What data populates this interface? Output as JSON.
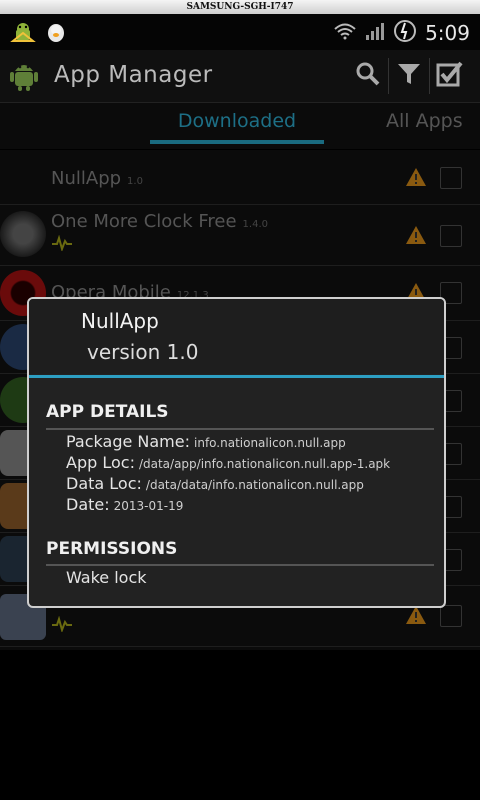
{
  "device": {
    "label": "SAMSUNG-SGH-I747"
  },
  "status": {
    "time": "5:09"
  },
  "header": {
    "title": "App Manager"
  },
  "icons": {
    "actions": [
      "search-icon",
      "filter-icon",
      "checkbox-check-icon"
    ],
    "status_left": [
      "android-debug-icon",
      "penguin-notification-icon"
    ],
    "status_right": [
      "wifi-icon",
      "signal-icon",
      "battery-icon"
    ]
  },
  "tabs": [
    {
      "label": "Downloaded",
      "active": true
    },
    {
      "label": "All Apps",
      "active": false
    }
  ],
  "apps": [
    {
      "name": "NullApp",
      "version": "1.0"
    },
    {
      "name": "One More Clock Free",
      "version": "1.4.0"
    },
    {
      "name": "Opera Mobile",
      "version": "12.1.3"
    }
  ],
  "dialog": {
    "title": "NullApp",
    "version": "version 1.0",
    "details_header": "APP DETAILS",
    "details": [
      {
        "label": "Package Name:",
        "value": "info.nationalicon.null.app"
      },
      {
        "label": "App Loc:",
        "value": "/data/app/info.nationalicon.null.app-1.apk"
      },
      {
        "label": "Data Loc:",
        "value": "/data/data/info.nationalicon.null.app"
      },
      {
        "label": "Date:",
        "value": "2013-01-19"
      }
    ],
    "permissions_header": "PERMISSIONS",
    "permissions": [
      "Wake lock"
    ]
  },
  "colors": {
    "accent": "#2d9fc3",
    "warning": "#e89b1a",
    "background": "#0b0b0b"
  }
}
